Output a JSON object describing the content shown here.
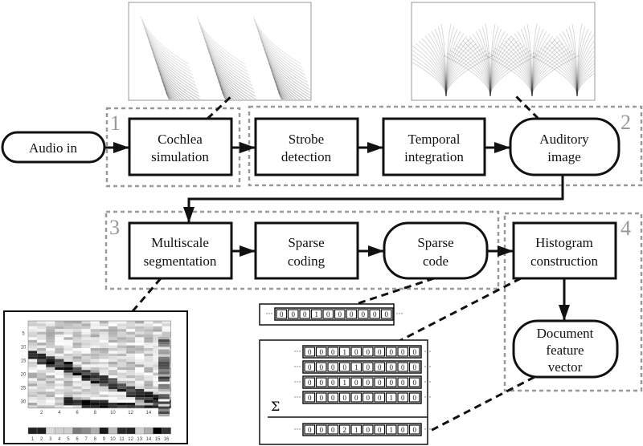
{
  "nodes": {
    "audio_in": "Audio in",
    "cochlea": [
      "Cochlea",
      "simulation"
    ],
    "strobe": [
      "Strobe",
      "detection"
    ],
    "temporal": [
      "Temporal",
      "integration"
    ],
    "auditory": [
      "Auditory",
      "image"
    ],
    "multiscale": [
      "Multiscale",
      "segmentation"
    ],
    "sparse_coding": [
      "Sparse",
      "coding"
    ],
    "sparse_code": [
      "Sparse",
      "code"
    ],
    "histogram": [
      "Histogram",
      "construction"
    ],
    "document": [
      "Document",
      "feature",
      "vector"
    ]
  },
  "groups": [
    "1",
    "2",
    "3",
    "4"
  ],
  "sparse_vector": [
    "0",
    "0",
    "0",
    "1",
    "0",
    "0",
    "0",
    "0",
    "0",
    "0"
  ],
  "histogram_rows": [
    [
      "0",
      "0",
      "0",
      "1",
      "0",
      "0",
      "0",
      "0",
      "0",
      "0"
    ],
    [
      "0",
      "0",
      "0",
      "0",
      "1",
      "0",
      "0",
      "0",
      "0",
      "0"
    ],
    [
      "0",
      "0",
      "0",
      "1",
      "0",
      "0",
      "0",
      "0",
      "0",
      "0"
    ],
    [
      "0",
      "0",
      "0",
      "0",
      "0",
      "0",
      "0",
      "1",
      "0",
      "0"
    ]
  ],
  "histogram_sum": [
    "0",
    "0",
    "0",
    "2",
    "1",
    "0",
    "0",
    "1",
    "0",
    "0"
  ],
  "sum_symbol": "Σ",
  "ellipsis": "···",
  "segment_plot": {
    "y_ticks": [
      "5",
      "10",
      "15",
      "20",
      "25",
      "30"
    ],
    "x_ticks": [
      "2",
      "4",
      "6",
      "8",
      "10",
      "12",
      "14",
      "16"
    ],
    "colorbar_ticks": [
      "1",
      "2",
      "3",
      "4",
      "5",
      "6",
      "7",
      "8",
      "9",
      "10",
      "11",
      "12",
      "13",
      "14",
      "15",
      "16"
    ]
  },
  "colors": {
    "box": "#111111",
    "group_dash": "#999999",
    "group_number": "#999999"
  }
}
